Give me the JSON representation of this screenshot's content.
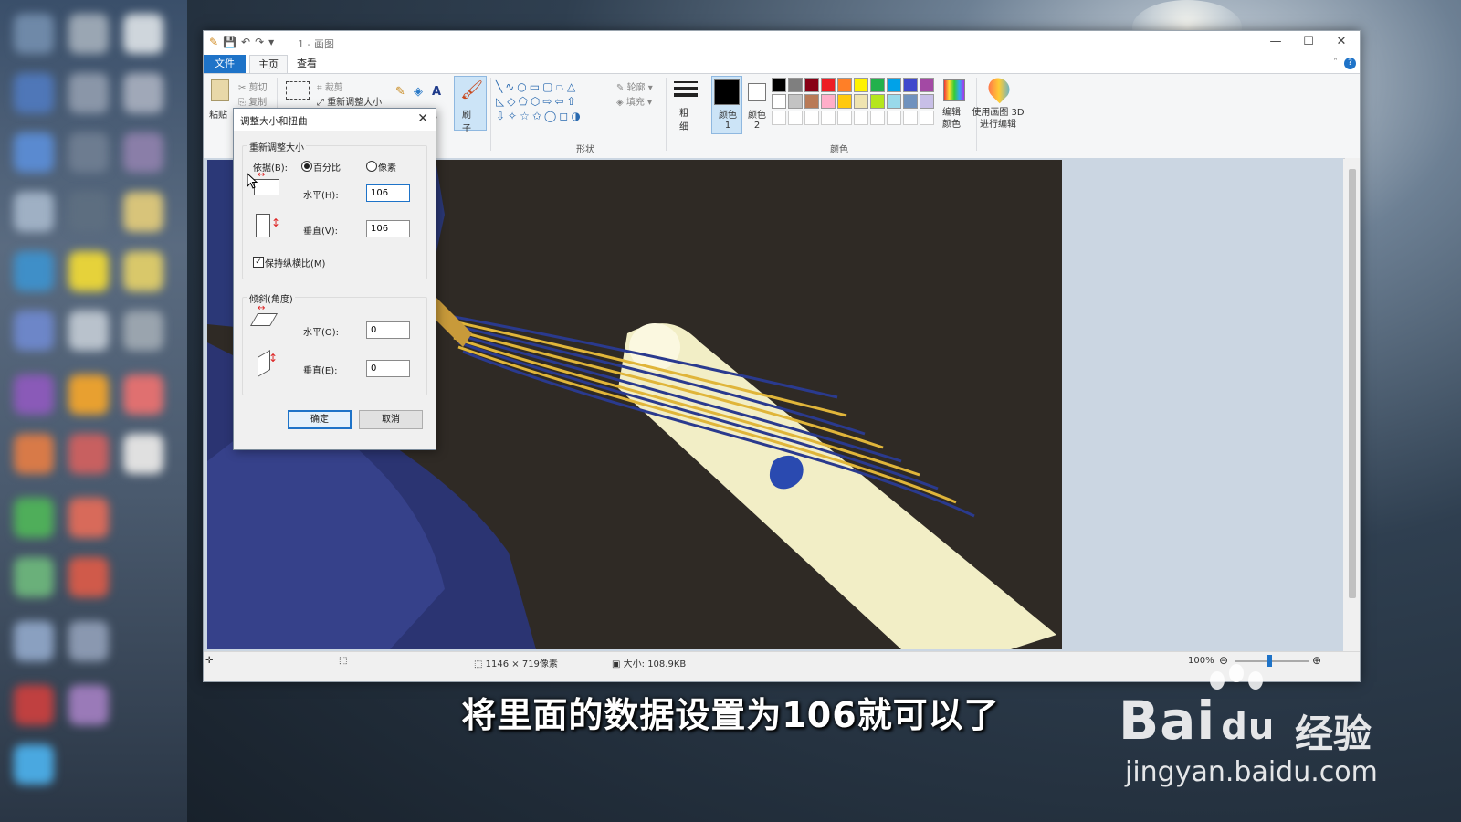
{
  "app": {
    "title": "1 - 画图"
  },
  "menu": {
    "file": "文件",
    "home": "主页",
    "view": "查看"
  },
  "ribbon": {
    "clipboard": {
      "paste": "粘贴",
      "cut": "剪切",
      "copy": "复制"
    },
    "image": {
      "crop": "裁剪",
      "resize": "重新调整大小"
    },
    "brush": "刷子",
    "shapes_label": "形状",
    "outline": "轮廓",
    "fill": "填充",
    "size": "粗细",
    "color1": "颜色 1",
    "color2": "颜色 2",
    "colors_label": "颜色",
    "edit_colors": "编辑颜色",
    "paint3d": "使用画图 3D 进行编辑",
    "palette_row1": [
      "#000000",
      "#7f7f7f",
      "#880015",
      "#ed1c24",
      "#ff7f27",
      "#fff200",
      "#22b14c",
      "#00a2e8",
      "#3f48cc",
      "#a349a4"
    ],
    "palette_row2": [
      "#ffffff",
      "#c3c3c3",
      "#b97a57",
      "#ffaec9",
      "#ffc90e",
      "#efe4b0",
      "#b5e61d",
      "#99d9ea",
      "#7092be",
      "#c8bfe7"
    ]
  },
  "dialog": {
    "title": "调整大小和扭曲",
    "resize_group": "重新调整大小",
    "by_label": "依据(B):",
    "percent": "百分比",
    "pixels": "像素",
    "horizontal_label": "水平(H):",
    "horizontal_value": "106",
    "vertical_label": "垂直(V):",
    "vertical_value": "106",
    "keep_ratio": "保持纵横比(M)",
    "skew_group": "倾斜(角度)",
    "skew_h_label": "水平(O):",
    "skew_h_value": "0",
    "skew_v_label": "垂直(E):",
    "skew_v_value": "0",
    "ok": "确定",
    "cancel": "取消"
  },
  "status": {
    "dimensions": "1146 × 719像素",
    "size": "大小: 108.9KB",
    "zoom": "100%"
  },
  "subtitle": "将里面的数据设置为106就可以了",
  "watermark": {
    "brand": "Bai",
    "brand2": "du",
    "cn": "经验",
    "url": "jingyan.baidu.com"
  }
}
